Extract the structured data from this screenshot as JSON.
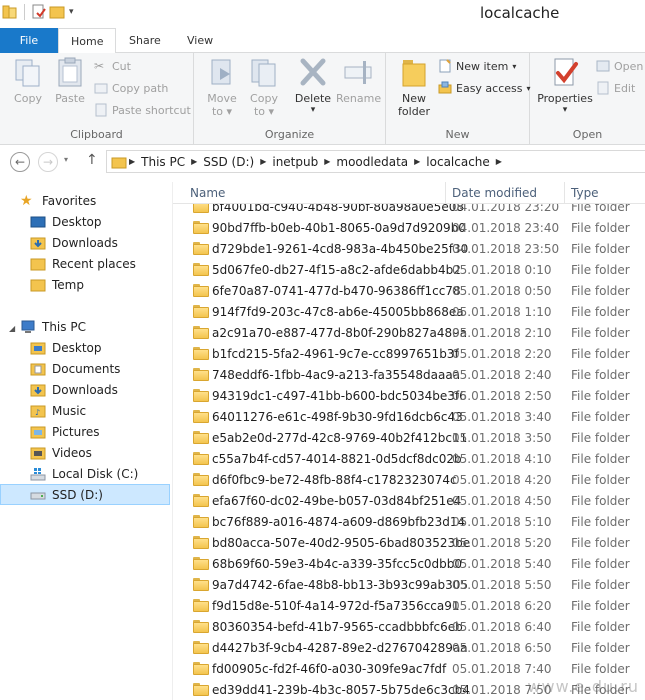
{
  "window": {
    "title": "localcache"
  },
  "colors": {
    "file_tab": "#1979ca",
    "selection": "#cde8ff",
    "folder": "#f3c44e",
    "column_header_text": "#4c607a"
  },
  "ribbon": {
    "tabs": [
      "File",
      "Home",
      "Share",
      "View"
    ],
    "clipboard": {
      "label": "Clipboard",
      "copy": "Copy",
      "paste": "Paste",
      "cut": "Cut",
      "copy_path": "Copy path",
      "paste_shortcut": "Paste shortcut"
    },
    "organize": {
      "label": "Organize",
      "move_to": "Move",
      "move_to_2": "to",
      "copy_to": "Copy",
      "copy_to_2": "to",
      "delete": "Delete",
      "rename": "Rename"
    },
    "new": {
      "label": "New",
      "new_folder": "New",
      "new_folder_2": "folder",
      "new_item": "New item",
      "easy_access": "Easy access"
    },
    "open": {
      "label": "Open",
      "properties": "Properties",
      "open": "Open",
      "edit": "Edit"
    }
  },
  "address": {
    "crumbs": [
      "This PC",
      "SSD (D:)",
      "inetpub",
      "moodledata",
      "localcache"
    ]
  },
  "nav": {
    "favorites": "Favorites",
    "fav_items": [
      "Desktop",
      "Downloads",
      "Recent places",
      "Temp"
    ],
    "this_pc": "This PC",
    "pc_items": [
      "Desktop",
      "Documents",
      "Downloads",
      "Music",
      "Pictures",
      "Videos",
      "Local Disk (C:)",
      "SSD (D:)"
    ]
  },
  "columns": {
    "name": "Name",
    "date": "Date modified",
    "type": "Type"
  },
  "files": [
    {
      "name": "bf4001bd-c940-4b48-90bf-80a98a0e5e08",
      "date": "04.01.2018 23:20",
      "type": "File folder"
    },
    {
      "name": "90bd7ffb-b0eb-40b1-8065-0a9d7d9209b0",
      "date": "04.01.2018 23:40",
      "type": "File folder"
    },
    {
      "name": "d729bde1-9261-4cd8-983a-4b450be25f30",
      "date": "04.01.2018 23:50",
      "type": "File folder"
    },
    {
      "name": "5d067fe0-db27-4f15-a8c2-afde6dabb4b2",
      "date": "05.01.2018 0:10",
      "type": "File folder"
    },
    {
      "name": "6fe70a87-0741-477d-b470-96386ff1cc78",
      "date": "05.01.2018 0:50",
      "type": "File folder"
    },
    {
      "name": "914f7fd9-203c-47c8-ab6e-45005bb868ea",
      "date": "05.01.2018 1:10",
      "type": "File folder"
    },
    {
      "name": "a2c91a70-e887-477d-8b0f-290b827a489a",
      "date": "05.01.2018 2:10",
      "type": "File folder"
    },
    {
      "name": "b1fcd215-5fa2-4961-9c7e-cc8997651b3f",
      "date": "05.01.2018 2:20",
      "type": "File folder"
    },
    {
      "name": "748eddf6-1fbb-4ac9-a213-fa35548daaaa",
      "date": "05.01.2018 2:40",
      "type": "File folder"
    },
    {
      "name": "94319dc1-c497-41bb-b600-bdc5034be3f6",
      "date": "05.01.2018 2:50",
      "type": "File folder"
    },
    {
      "name": "64011276-e61c-498f-9b30-9fd16dcb6c43",
      "date": "05.01.2018 3:40",
      "type": "File folder"
    },
    {
      "name": "e5ab2e0d-277d-42c8-9769-40b2f412bc11",
      "date": "05.01.2018 3:50",
      "type": "File folder"
    },
    {
      "name": "c55a7b4f-cd57-4014-8821-0d5dcf8dc02b",
      "date": "05.01.2018 4:10",
      "type": "File folder"
    },
    {
      "name": "d6f0fbc9-be72-48fb-88f4-c1782323074c",
      "date": "05.01.2018 4:20",
      "type": "File folder"
    },
    {
      "name": "efa67f60-dc02-49be-b057-03d84bf251e4",
      "date": "05.01.2018 4:50",
      "type": "File folder"
    },
    {
      "name": "bc76f889-a016-4874-a609-d869bfb23d14",
      "date": "05.01.2018 5:10",
      "type": "File folder"
    },
    {
      "name": "bd80acca-507e-40d2-9505-6bad803523be",
      "date": "05.01.2018 5:20",
      "type": "File folder"
    },
    {
      "name": "68b69f60-59e3-4b4c-a339-35fcc5c0dbb0",
      "date": "05.01.2018 5:40",
      "type": "File folder"
    },
    {
      "name": "9a7d4742-6fae-48b8-bb13-3b93c99ab305",
      "date": "05.01.2018 5:50",
      "type": "File folder"
    },
    {
      "name": "f9d15d8e-510f-4a14-972d-f5a7356cca91",
      "date": "05.01.2018 6:20",
      "type": "File folder"
    },
    {
      "name": "80360354-befd-41b7-9565-ccadbbbfc6eb",
      "date": "05.01.2018 6:40",
      "type": "File folder"
    },
    {
      "name": "d4427b3f-9cb4-4287-89e2-d276704289aa",
      "date": "05.01.2018 6:50",
      "type": "File folder"
    },
    {
      "name": "fd00905c-fd2f-46f0-a030-309fe9ac7fdf",
      "date": "05.01.2018 7:40",
      "type": "File folder"
    },
    {
      "name": "ed39dd41-239b-4b3c-8057-5b75de6c3cb4",
      "date": "05.01.2018 7:50",
      "type": "File folder"
    }
  ],
  "watermark": "www.e-du.ru"
}
